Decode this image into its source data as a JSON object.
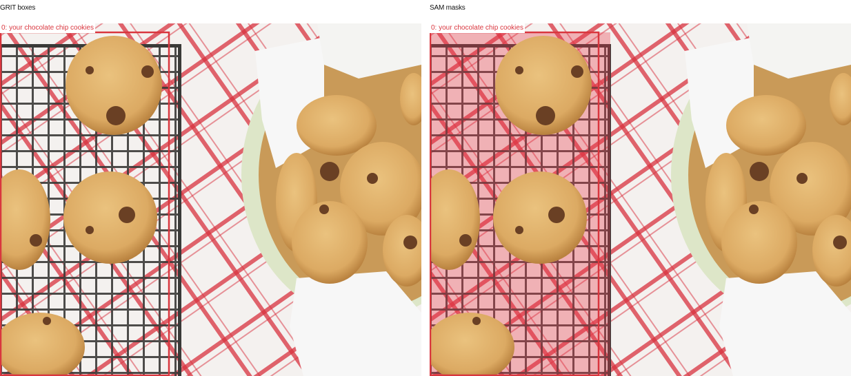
{
  "panels": [
    {
      "title": "GRIT boxes",
      "box_label": "0: your chocolate chip cookies",
      "overlay": "box"
    },
    {
      "title": "SAM masks",
      "box_label": "0: your chocolate chip cookies",
      "overlay": "mask"
    }
  ],
  "colors": {
    "box": "#d9363e",
    "mask_fill": "#e8394a",
    "tablecloth": "#f4f1ef",
    "plaid_red": "#d8323f",
    "rack": "#3a3a38",
    "cookie": "#dcaa63",
    "cookie_edge": "#b9823f",
    "chip": "#6a4024",
    "tin": "#dde6c8",
    "paper": "#f7f7f7"
  }
}
